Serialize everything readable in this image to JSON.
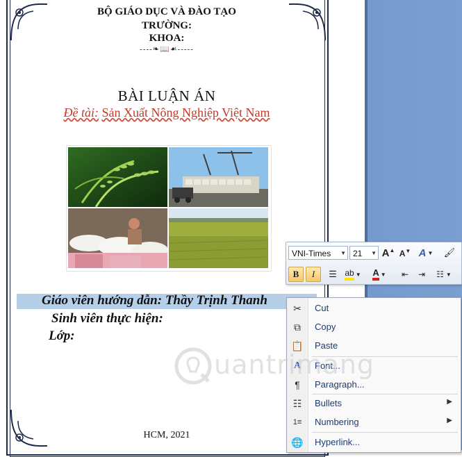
{
  "document": {
    "header": {
      "ministry": "BỘ GIÁO DỤC VÀ ĐÀO TẠO",
      "school": "TRƯỜNG:",
      "faculty": "KHOA:",
      "ornament": "----❧📖☙-----"
    },
    "title": "BÀI LUẬN ÁN",
    "subtitle_label": "Đề tài:",
    "subtitle_text": "Sản Xuất Nông Nghiệp Việt Nam",
    "supervisor_line": "Giáo viên hướng dẫn: Thầy Trịnh Thanh",
    "student_line": "Sinh viên thực hiện:",
    "class_line": "Lớp:",
    "footer": "HCM, 2021",
    "collage_images": [
      "rice-plant",
      "rice-port-trucks",
      "rice-market-vendor",
      "rice-field"
    ]
  },
  "mini_toolbar": {
    "font_name": "VNI-Times",
    "font_size": "21",
    "grow_font": "A",
    "shrink_font": "A",
    "bold": "B",
    "italic": "I",
    "highlight_color": "#ffe600",
    "font_color": "#d21f1f"
  },
  "context_menu": {
    "items": [
      {
        "label": "Cut",
        "icon": "scissors-icon",
        "submenu": false
      },
      {
        "label": "Copy",
        "icon": "copy-icon",
        "submenu": false
      },
      {
        "label": "Paste",
        "icon": "paste-icon",
        "submenu": false
      },
      {
        "label": "Font...",
        "icon": "font-icon",
        "submenu": false
      },
      {
        "label": "Paragraph...",
        "icon": "paragraph-icon",
        "submenu": false
      },
      {
        "label": "Bullets",
        "icon": "bullets-icon",
        "submenu": true
      },
      {
        "label": "Numbering",
        "icon": "numbering-icon",
        "submenu": true
      },
      {
        "label": "Hyperlink...",
        "icon": "hyperlink-icon",
        "submenu": false
      }
    ]
  },
  "watermark": {
    "text": "uantrimang"
  },
  "colors": {
    "selection": "#b6cfe9",
    "app_background": "#7b9fd2",
    "menu_text": "#1d3b6e",
    "subtitle": "#c0392b"
  }
}
